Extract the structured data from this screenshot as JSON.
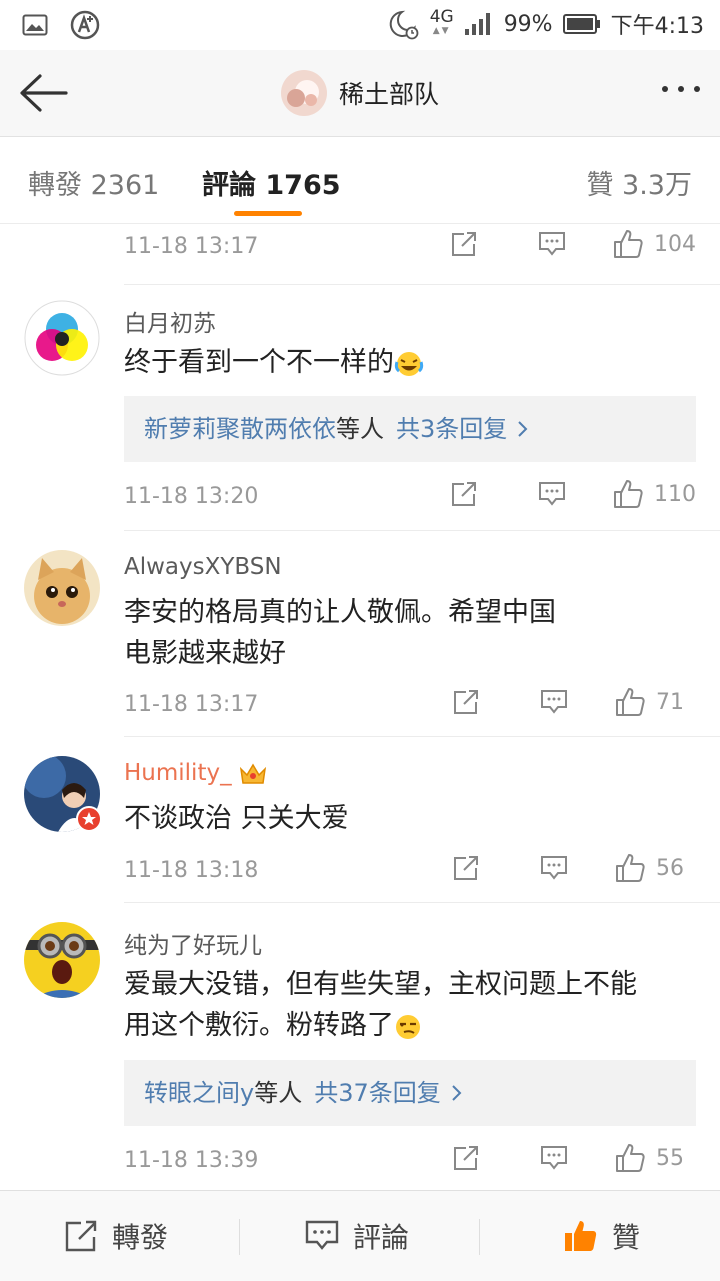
{
  "status_bar": {
    "network": "4G",
    "battery": "99%",
    "time": "下午4:13",
    "icons": [
      "image-icon",
      "a-circle-icon",
      "moon-alarm-icon",
      "signal-icon",
      "battery-icon"
    ]
  },
  "nav": {
    "title": "稀土部队",
    "back_icon": "arrow-left-icon",
    "more_icon": "more-dots-icon"
  },
  "tabs": {
    "repost": "轉發 2361",
    "comments": "評論 1765",
    "likes": "贊 3.3万",
    "active_color": "#ff8200"
  },
  "comments": [
    {
      "time": "11-18 13:17",
      "likes": "104"
    },
    {
      "name": "白月初苏",
      "text": "终于看到一个不一样的",
      "reply_users": "新萝莉聚散两依依",
      "reply_mid": "等人",
      "reply_count": "共3条回复",
      "time": "11-18 13:20",
      "likes": "110"
    },
    {
      "name": "AlwaysXYBSN",
      "text_line1": "李安的格局真的让人敬佩。希望中国",
      "text_line2": "电影越来越好",
      "time": "11-18 13:17",
      "likes": "71"
    },
    {
      "name": "Humility_",
      "text": "不谈政治 只关大爱",
      "time": "11-18 13:18",
      "likes": "56"
    },
    {
      "name": "纯为了好玩儿",
      "text_line1": "爱最大没错，但有些失望，主权问题上不能",
      "text_line2": "用这个敷衍。粉转路了",
      "reply_users": "转眼之间y",
      "reply_mid": "等人",
      "reply_count": "共37条回复",
      "time": "11-18 13:39",
      "likes": "55"
    }
  ],
  "bottom_bar": {
    "repost": "轉發",
    "comment": "評論",
    "like": "贊",
    "like_color": "#ff8200"
  }
}
